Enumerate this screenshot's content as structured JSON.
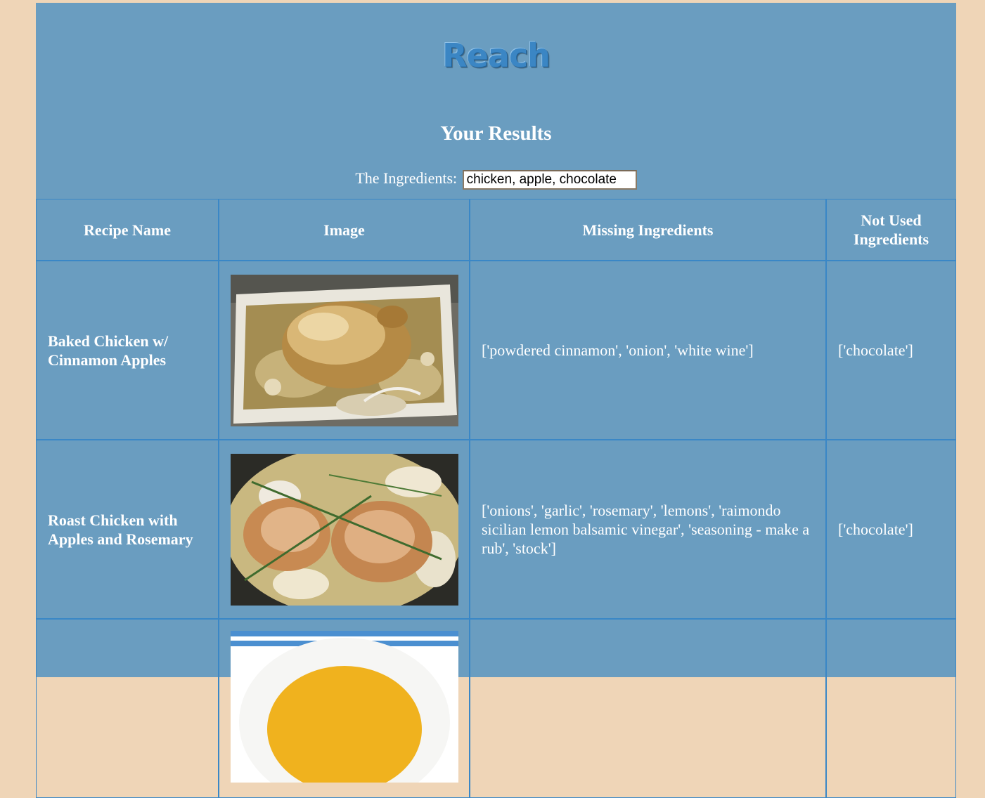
{
  "header": {
    "logo": "Reach",
    "title": "Your Results",
    "ingredients_label": "The Ingredients:",
    "ingredients_value": "chicken, apple, chocolate"
  },
  "table": {
    "columns": [
      "Recipe Name",
      "Image",
      "Missing Ingredients",
      "Not Used Ingredients"
    ],
    "rows": [
      {
        "name": "Baked Chicken w/ Cinnamon Apples",
        "image": "roast-chicken-photo",
        "missing": "['powdered cinnamon', 'onion', 'white wine']",
        "not_used": "['chocolate']"
      },
      {
        "name": "Roast Chicken with Apples and Rosemary",
        "image": "chicken-rosemary-photo",
        "missing": "['onions', 'garlic', 'rosemary', 'lemons', 'raimondo sicilian lemon balsamic vinegar', 'seasoning - make a rub', 'stock']",
        "not_used": "['chocolate']"
      },
      {
        "name": "",
        "image": "soup-bowl-photo",
        "missing": "",
        "not_used": ""
      }
    ]
  },
  "colors": {
    "page_bg": "#efd5b7",
    "panel_bg": "#6a9dc0",
    "border": "#3a87c6",
    "logo": "#3b86c4"
  }
}
